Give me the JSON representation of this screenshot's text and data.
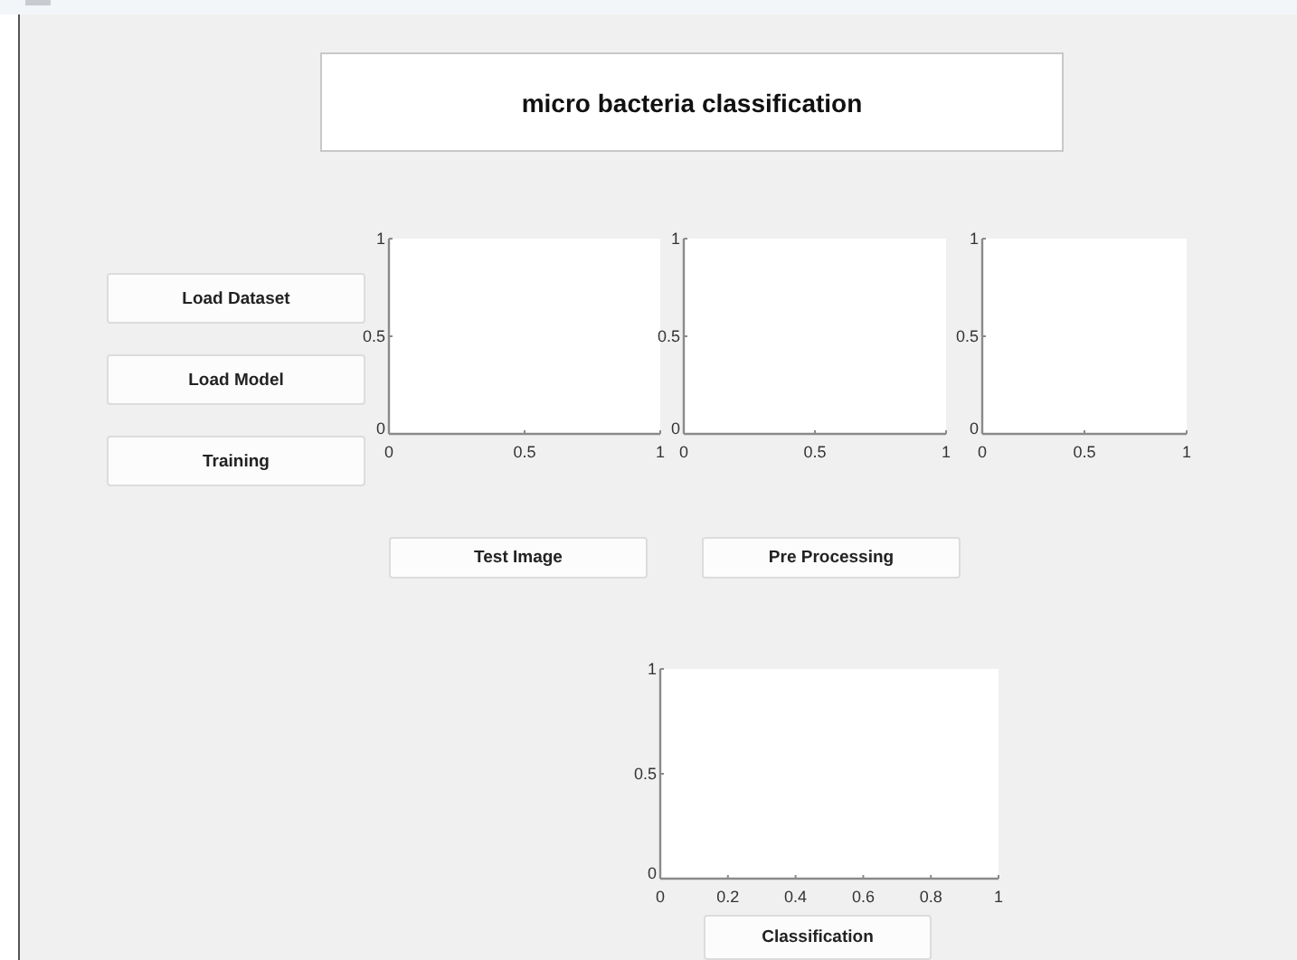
{
  "title": "micro bacteria classification",
  "side_buttons": [
    "Load Dataset",
    "Load Model",
    "Training"
  ],
  "axes": [
    {
      "chart_data": {
        "type": "line",
        "xlim": [
          0,
          1
        ],
        "ylim": [
          0,
          1
        ],
        "xticks": [
          0,
          0.5,
          1
        ],
        "yticks": [
          0,
          0.5,
          1
        ]
      }
    },
    {
      "chart_data": {
        "type": "line",
        "xlim": [
          0,
          1
        ],
        "ylim": [
          0,
          1
        ],
        "xticks": [
          0,
          0.5,
          1
        ],
        "yticks": [
          0,
          0.5,
          1
        ]
      }
    },
    {
      "chart_data": {
        "type": "line",
        "xlim": [
          0,
          1
        ],
        "ylim": [
          0,
          1
        ],
        "xticks": [
          0,
          0.5,
          1
        ],
        "yticks": [
          0,
          0.5,
          1
        ]
      }
    }
  ],
  "image_buttons": [
    "Test Image",
    "Pre Processing"
  ],
  "result_axes": {
    "chart_data": {
      "type": "line",
      "xlim": [
        0,
        1
      ],
      "ylim": [
        0,
        1
      ],
      "xticks": [
        0,
        0.2,
        0.4,
        0.6,
        0.8,
        1
      ],
      "yticks": [
        0,
        0.5,
        1
      ]
    }
  },
  "classify_button": "Classification"
}
